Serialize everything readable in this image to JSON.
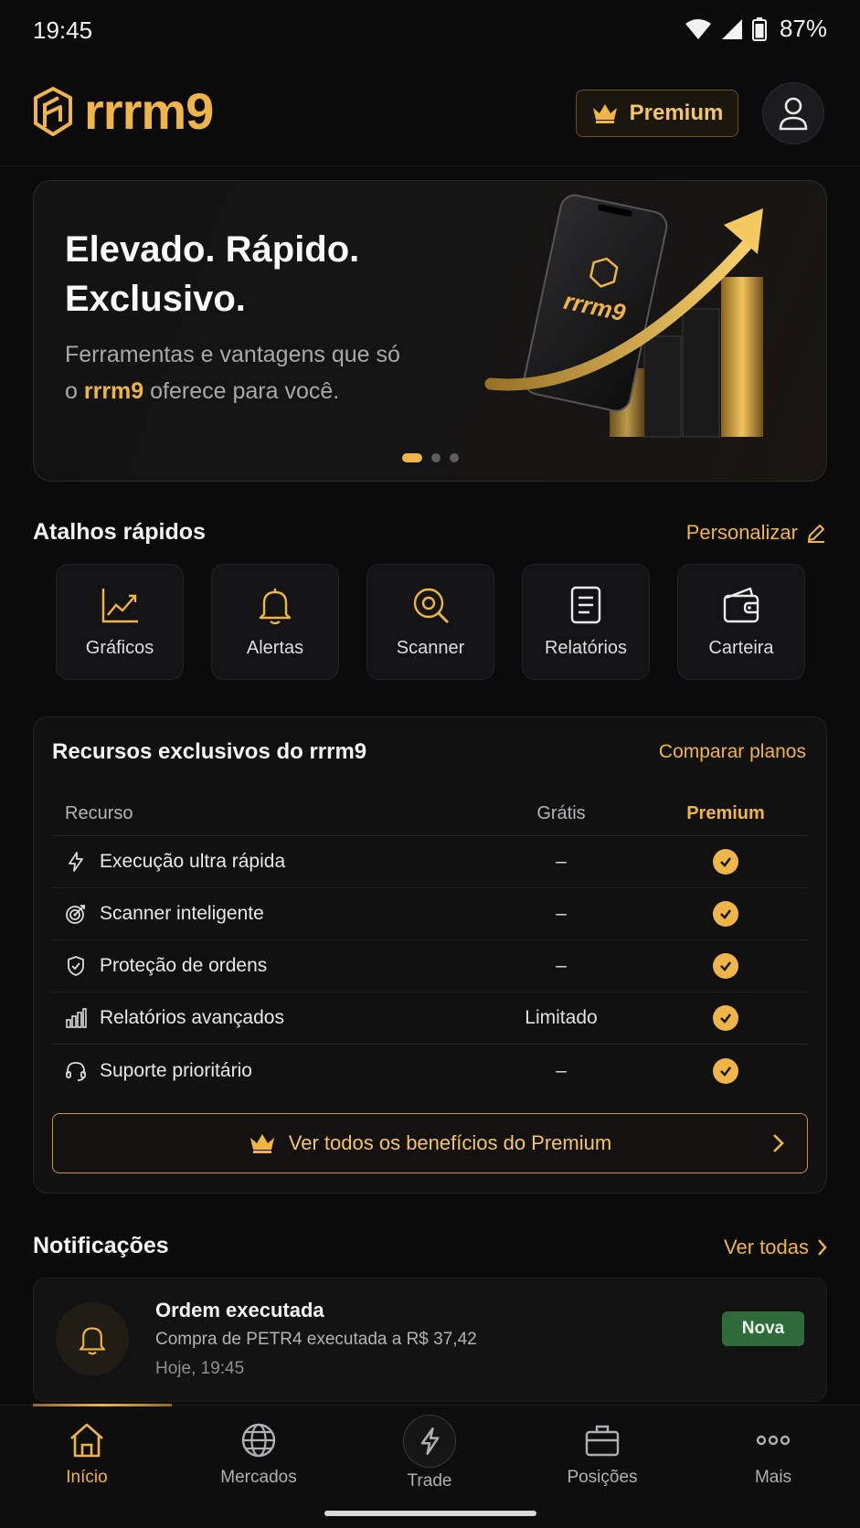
{
  "status_bar": {
    "time": "19:45",
    "battery": "87%"
  },
  "header": {
    "logo_text": "rrrm9",
    "premium_label": "Premium"
  },
  "hero": {
    "title_line1": "Elevado. Rápido.",
    "title_line2": "Exclusivo.",
    "subtitle_part1": "Ferramentas e vantagens que só o ",
    "subtitle_brand": "rrrm9",
    "subtitle_part2": " oferece para você.",
    "phone_logo": "rrrm9",
    "carousel": {
      "pages": 3,
      "active": 1
    }
  },
  "shortcuts": {
    "title": "Atalhos rápidos",
    "customize_label": "Personalizar",
    "items": [
      {
        "label": "Gráficos",
        "icon": "chart-line-icon"
      },
      {
        "label": "Alertas",
        "icon": "bell-icon"
      },
      {
        "label": "Scanner",
        "icon": "scanner-icon"
      },
      {
        "label": "Relatórios",
        "icon": "report-icon"
      },
      {
        "label": "Carteira",
        "icon": "wallet-icon"
      }
    ]
  },
  "features": {
    "title": "Recursos exclusivos do rrrm9",
    "compare_label": "Comparar planos",
    "headers": {
      "feature": "Recurso",
      "free": "Grátis",
      "premium": "Premium"
    },
    "rows": [
      {
        "name": "Execução ultra rápida",
        "free": "–",
        "icon": "bolt-icon",
        "premium_included": true
      },
      {
        "name": "Scanner inteligente",
        "free": "–",
        "icon": "target-icon",
        "premium_included": true
      },
      {
        "name": "Proteção de ordens",
        "free": "–",
        "icon": "shield-icon",
        "premium_included": true
      },
      {
        "name": "Relatórios avançados",
        "free": "Limitado",
        "icon": "bar-chart-icon",
        "premium_included": true
      },
      {
        "name": "Suporte prioritário",
        "free": "–",
        "icon": "headset-icon",
        "premium_included": true
      }
    ],
    "benefits_button": "Ver todos os benefícios do Premium"
  },
  "notifications": {
    "title": "Notificações",
    "see_all_label": "Ver todas",
    "items": [
      {
        "title": "Ordem executada",
        "body": "Compra de PETR4 executada a R$ 37,42",
        "time": "Hoje, 19:45",
        "badge": "Nova"
      }
    ]
  },
  "bottom_nav": {
    "items": [
      {
        "label": "Início",
        "icon": "home-icon",
        "active": true
      },
      {
        "label": "Mercados",
        "icon": "globe-icon",
        "active": false
      },
      {
        "label": "Trade",
        "icon": "bolt-icon",
        "active": false
      },
      {
        "label": "Posições",
        "icon": "briefcase-icon",
        "active": false
      },
      {
        "label": "Mais",
        "icon": "more-icon",
        "active": false
      }
    ]
  },
  "colors": {
    "accent": "#f0b549",
    "background": "#0b0b0c",
    "card": "#131314",
    "badge_new": "#2f6b3a"
  }
}
